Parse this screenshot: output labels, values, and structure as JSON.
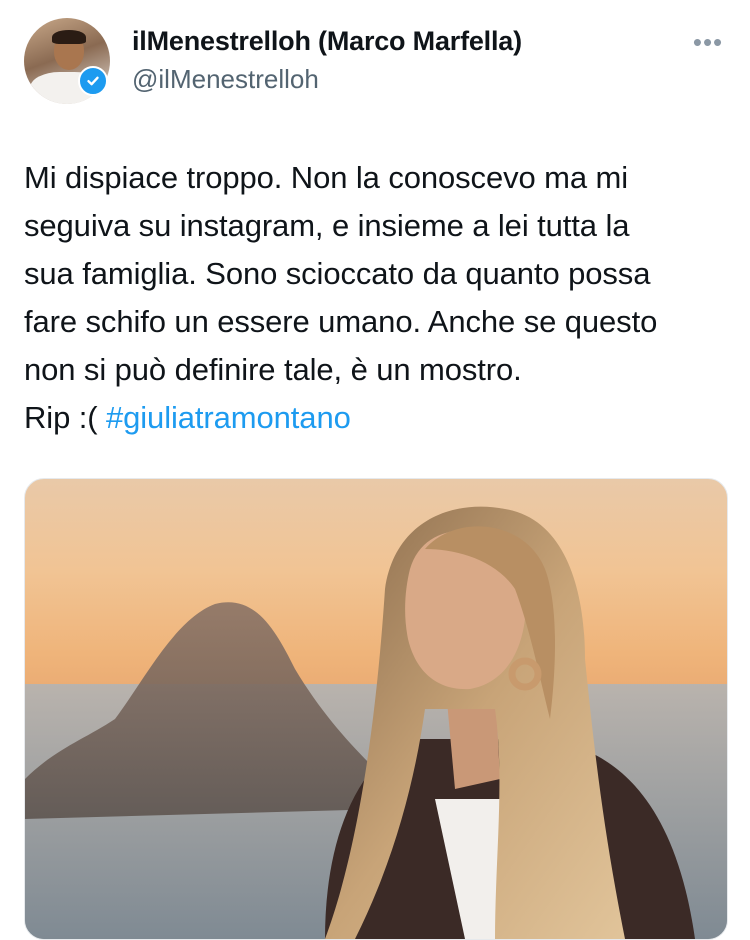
{
  "tweet": {
    "author": {
      "display_name": "ilMenestrelloh (Marco Marfella)",
      "handle": "@ilMenestrelloh",
      "verified": true,
      "avatar_icon": "avatar-photo"
    },
    "more_icon": "more-horizontal-icon",
    "more_label": "•••",
    "text_lines": [
      "Mi dispiace troppo. Non la conoscevo ma mi",
      "seguiva su instagram, e insieme a lei tutta la",
      "sua famiglia. Sono scioccato da quanto possa",
      "fare schifo un essere umano. Anche se questo",
      "non si può definire tale, è un mostro."
    ],
    "last_line_prefix": "Rip :( ",
    "hashtag": "#giuliatramontano",
    "media": {
      "type": "photo"
    }
  },
  "colors": {
    "link": "#1d9bf0",
    "secondary_text": "#536471",
    "verified_badge": "#1d9bf0"
  }
}
